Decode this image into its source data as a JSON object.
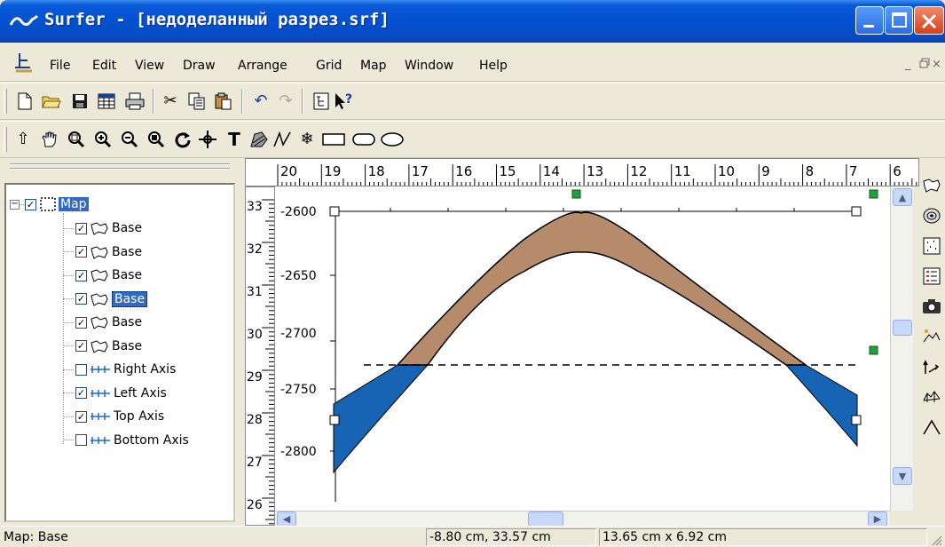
{
  "window": {
    "title": "Surfer - [недоделанный разрез.srf]"
  },
  "menu": {
    "items": [
      {
        "label": "File"
      },
      {
        "label": "Edit"
      },
      {
        "label": "View"
      },
      {
        "label": "Draw"
      },
      {
        "label": "Arrange"
      },
      {
        "label": "Grid"
      },
      {
        "label": "Map"
      },
      {
        "label": "Window"
      },
      {
        "label": "Help"
      }
    ],
    "mdi_minimize": "_",
    "mdi_restore": "ð",
    "mdi_close": "×"
  },
  "tree": {
    "root": "Map",
    "items": [
      {
        "label": "Base",
        "checked": true,
        "type": "base",
        "selected": false
      },
      {
        "label": "Base",
        "checked": true,
        "type": "base",
        "selected": false
      },
      {
        "label": "Base",
        "checked": true,
        "type": "base",
        "selected": false
      },
      {
        "label": "Base",
        "checked": true,
        "type": "base",
        "selected": true
      },
      {
        "label": "Base",
        "checked": true,
        "type": "base",
        "selected": false
      },
      {
        "label": "Base",
        "checked": true,
        "type": "base",
        "selected": false
      },
      {
        "label": "Right Axis",
        "checked": false,
        "type": "axis",
        "selected": false
      },
      {
        "label": "Left Axis",
        "checked": true,
        "type": "axis",
        "selected": false
      },
      {
        "label": "Top Axis",
        "checked": true,
        "type": "axis",
        "selected": false
      },
      {
        "label": "Bottom Axis",
        "checked": false,
        "type": "axis",
        "selected": false
      }
    ]
  },
  "rulers": {
    "top_labels": [
      "20",
      "19",
      "18",
      "17",
      "16",
      "15",
      "14",
      "13",
      "12",
      "11",
      "10",
      "9",
      "8",
      "7",
      "6"
    ],
    "left_labels": [
      "33",
      "32",
      "31",
      "30",
      "29",
      "28",
      "27",
      "26"
    ]
  },
  "map": {
    "y_axis_labels": [
      "-2600",
      "-2650",
      "-2700",
      "-2750",
      "-2800"
    ],
    "colors": {
      "layer": "#b58b6c",
      "water": "#1864b4",
      "handle": "#22a03c"
    }
  },
  "status": {
    "left": "Map: Base",
    "cursor": "-8.80 cm, 33.57 cm",
    "size": "13.65 cm x 6.92 cm"
  }
}
